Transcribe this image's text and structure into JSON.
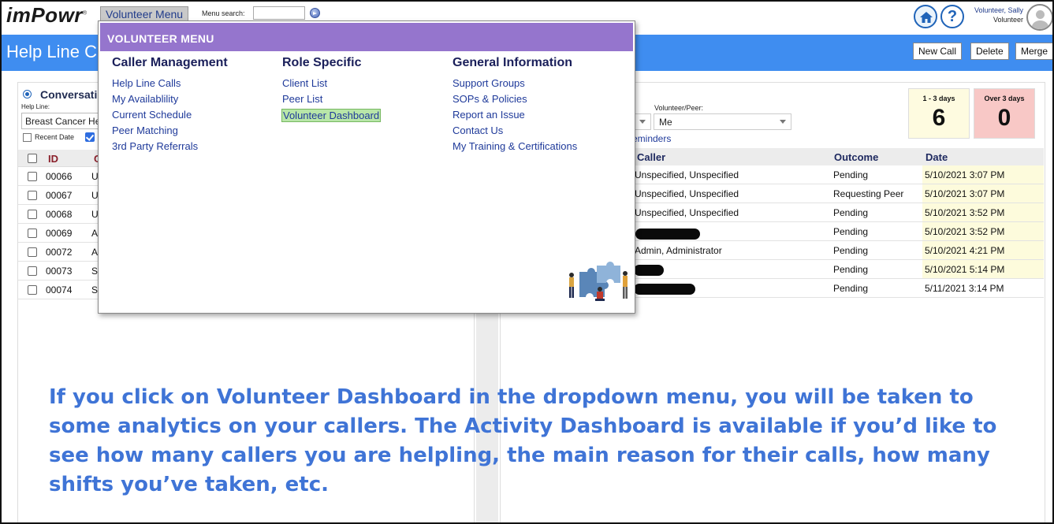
{
  "app": {
    "logo": "imPowr",
    "logo_mark": "®",
    "page_title": "Help Line C"
  },
  "topbar": {
    "volunteer_menu_label": "Volunteer Menu",
    "menu_search_label": "Menu search:",
    "menu_search_value": "",
    "user_name": "Volunteer, Sally",
    "user_role": "Volunteer"
  },
  "header_buttons": {
    "new_call": "New Call",
    "delete": "Delete",
    "merge": "Merge"
  },
  "left_panel": {
    "conversation_label": "Conversati",
    "help_line_label": "Help Line:",
    "help_line_value": "Breast Cancer He",
    "recent_date_label": "Recent Date",
    "columns": {
      "id": "ID",
      "c": "C"
    },
    "rows": [
      {
        "id": "00066",
        "c": "U"
      },
      {
        "id": "00067",
        "c": "U"
      },
      {
        "id": "00068",
        "c": "U"
      },
      {
        "id": "00069",
        "c": "A"
      },
      {
        "id": "00072",
        "c": "A"
      },
      {
        "id": "00073",
        "c": "S"
      },
      {
        "id": "00074",
        "c": "S"
      }
    ]
  },
  "right_panel": {
    "volunteer_peer_label": "Volunteer/Peer:",
    "volunteer_peer_value": "Me",
    "reminders_link": "eminders",
    "stats": [
      {
        "label": "1 - 3 days",
        "value": "6",
        "color": "#fefbe0"
      },
      {
        "label": "Over 3 days",
        "value": "0",
        "color": "#f8c8c6"
      }
    ],
    "columns": {
      "caller": "Caller",
      "outcome": "Outcome",
      "date": "Date"
    },
    "rows": [
      {
        "caller": "Unspecified, Unspecified",
        "outcome": "Pending",
        "date": "5/10/2021 3:07 PM"
      },
      {
        "caller": "Unspecified, Unspecified",
        "outcome": "Requesting Peer",
        "date": "5/10/2021 3:07 PM"
      },
      {
        "caller": "Unspecified, Unspecified",
        "outcome": "Pending",
        "date": "5/10/2021 3:52 PM"
      },
      {
        "caller": "",
        "outcome": "Pending",
        "date": "5/10/2021 3:52 PM"
      },
      {
        "caller": "Admin, Administrator",
        "outcome": "Pending",
        "date": "5/10/2021 4:21 PM"
      },
      {
        "caller": "",
        "outcome": "Pending",
        "date": "5/10/2021 5:14 PM"
      },
      {
        "caller": "",
        "outcome": "Pending",
        "date": "5/11/2021 3:14 PM"
      }
    ]
  },
  "volunteer_menu": {
    "title": "VOLUNTEER MENU",
    "columns": [
      {
        "heading": "Caller Management",
        "items": [
          "Help Line Calls",
          "My Availablility",
          "Current Schedule",
          "Peer Matching",
          "3rd Party Referrals"
        ]
      },
      {
        "heading": "Role Specific",
        "items": [
          "Client List",
          "Peer List",
          "Volunteer Dashboard"
        ]
      },
      {
        "heading": "General Information",
        "items": [
          "Support Groups",
          "SOPs & Policies",
          "Report an Issue",
          "Contact Us",
          "My Training & Certifications"
        ]
      }
    ],
    "highlighted_item": "Volunteer Dashboard"
  },
  "caption": "If you click on Volunteer Dashboard in the dropdown menu, you will be taken to some analytics on your callers. The Activity Dashboard  is available if you’d like to see how many callers you are helpling, the main reason for their calls, how many shifts you’ve taken, etc.",
  "colors": {
    "header_blue": "#3f8df0",
    "menu_purple": "#9575cd",
    "caption_blue": "#3f74d6",
    "highlight_green": "#b8e6a8",
    "date_cell_yellow": "#fdfbdc"
  }
}
